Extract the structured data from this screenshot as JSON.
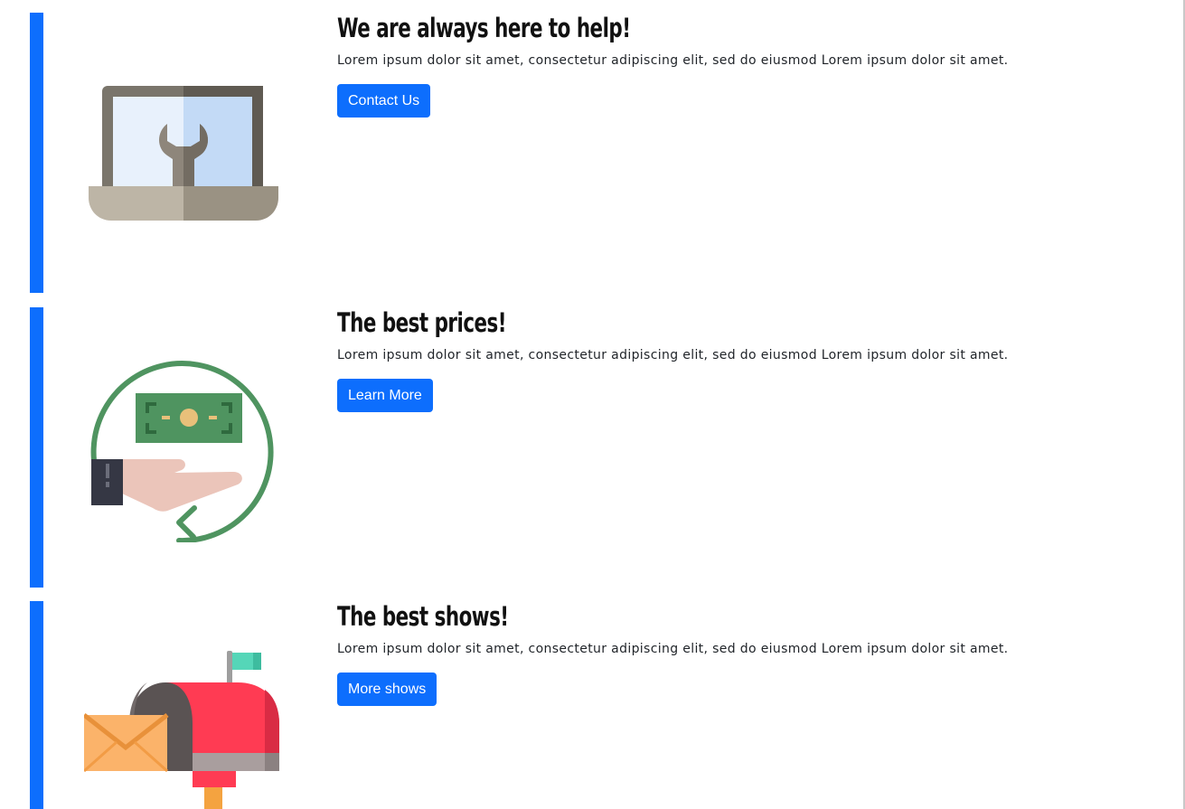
{
  "features": [
    {
      "title": "We are always here to help!",
      "description": "Lorem ipsum dolor sit amet, consectetur adipiscing elit, sed do eiusmod Lorem ipsum dolor sit amet.",
      "button_label": "Contact Us",
      "icon": "laptop-wrench-icon"
    },
    {
      "title": "The best prices!",
      "description": "Lorem ipsum dolor sit amet, consectetur adipiscing elit, sed do eiusmod Lorem ipsum dolor sit amet.",
      "button_label": "Learn More",
      "icon": "money-hand-icon"
    },
    {
      "title": "The best shows!",
      "description": "Lorem ipsum dolor sit amet, consectetur adipiscing elit, sed do eiusmod Lorem ipsum dolor sit amet.",
      "button_label": "More shows",
      "icon": "mailbox-icon"
    }
  ],
  "colors": {
    "accent": "#0d6efd",
    "button_text": "#ffffff",
    "title": "#111111"
  }
}
